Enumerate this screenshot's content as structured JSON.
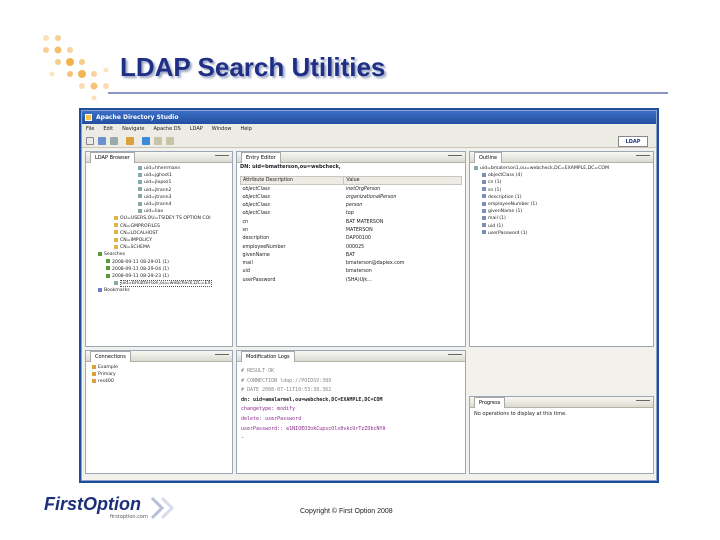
{
  "slide": {
    "title": "LDAP Search Utilities",
    "copyright": "Copyright © First Option 2008"
  },
  "logo": {
    "name": "FirstOption",
    "sub": "firstoption.com"
  },
  "app": {
    "window_title": "Apache Directory Studio",
    "menu": [
      "File",
      "Edit",
      "Navigate",
      "Apache DS",
      "LDAP",
      "Window",
      "Help"
    ],
    "perspective_button": "LDAP"
  },
  "ldap_browser": {
    "tab": "LDAP Browser",
    "items": [
      "uid=hherrmann",
      "uid=jghost1",
      "uid=jlopez1",
      "uid=jtrann2",
      "uid=jtrann3",
      "uid=jtrann4",
      "uid=liao",
      "OU=USERS,OU=TSIDEY TS OPTION COI",
      "CN=GMPROFILES",
      "CN=LOCALHOST",
      "CN=IMPOLICY",
      "CN=SCHEMA",
      "Searches",
      "2008-09-11 08-29-01 (1)",
      "2008-09-11 08-29-04 (1)",
      "2008-09-11 08-29-23 (1)",
      "uid=bmatterson,ou=webcheck,DC=EX",
      "Bookmarks"
    ]
  },
  "entry_editor": {
    "tab": "Entry Editor",
    "dn": "DN: uid=bmatterson,ou=webcheck,",
    "headers": [
      "Attribute Description",
      "Value"
    ],
    "rows": [
      [
        "objectClass",
        "inetOrgPerson"
      ],
      [
        "objectClass",
        "organizationalPerson"
      ],
      [
        "objectClass",
        "person"
      ],
      [
        "objectClass",
        "top"
      ],
      [
        "cn",
        "BAT MATERSON"
      ],
      [
        "sn",
        "MATERSON"
      ],
      [
        "description",
        "DAP00100"
      ],
      [
        "employeeNumber",
        "000025"
      ],
      [
        "givenName",
        "BAT"
      ],
      [
        "mail",
        "bmaterson@dapiex.com"
      ],
      [
        "uid",
        "bmaterson"
      ],
      [
        "userPassword",
        "(SHA)Ujk..."
      ]
    ]
  },
  "outline": {
    "tab": "Outline",
    "root": "uid=bmaterson1,ou=webcheck,DC=EXAMPLE,DC=COM",
    "items": [
      "objectClass (4)",
      "cn (1)",
      "sn (1)",
      "description (1)",
      "employeeNumber (1)",
      "givenName (1)",
      "mail (1)",
      "uid (1)",
      "userPassword (1)"
    ]
  },
  "connections": {
    "tab": "Connections",
    "items": [
      "Example",
      "Primary",
      "res400"
    ]
  },
  "modification_logs": {
    "tab": "Modification Logs",
    "lines": [
      "# RESULT OK",
      "# CONNECTION ldap://POIDSV:389",
      "# DATE 2008-07-11T10:53:38.362",
      "dn: uid=amalarmel,ou=webcheck,DC=EXAMPLE,DC=COM",
      "changetype: modify",
      "delete: userPassword",
      "userPassword:: e1NIOEO3okCupscOlx0vkcUrTzZObcNYA",
      "-"
    ]
  },
  "progress": {
    "tab": "Progress",
    "message": "No operations to display at this time."
  },
  "colors": {
    "slide_title": "#1f2f86",
    "screen_frame": "#1d4f9c",
    "accent_dots": "#f0a030"
  }
}
